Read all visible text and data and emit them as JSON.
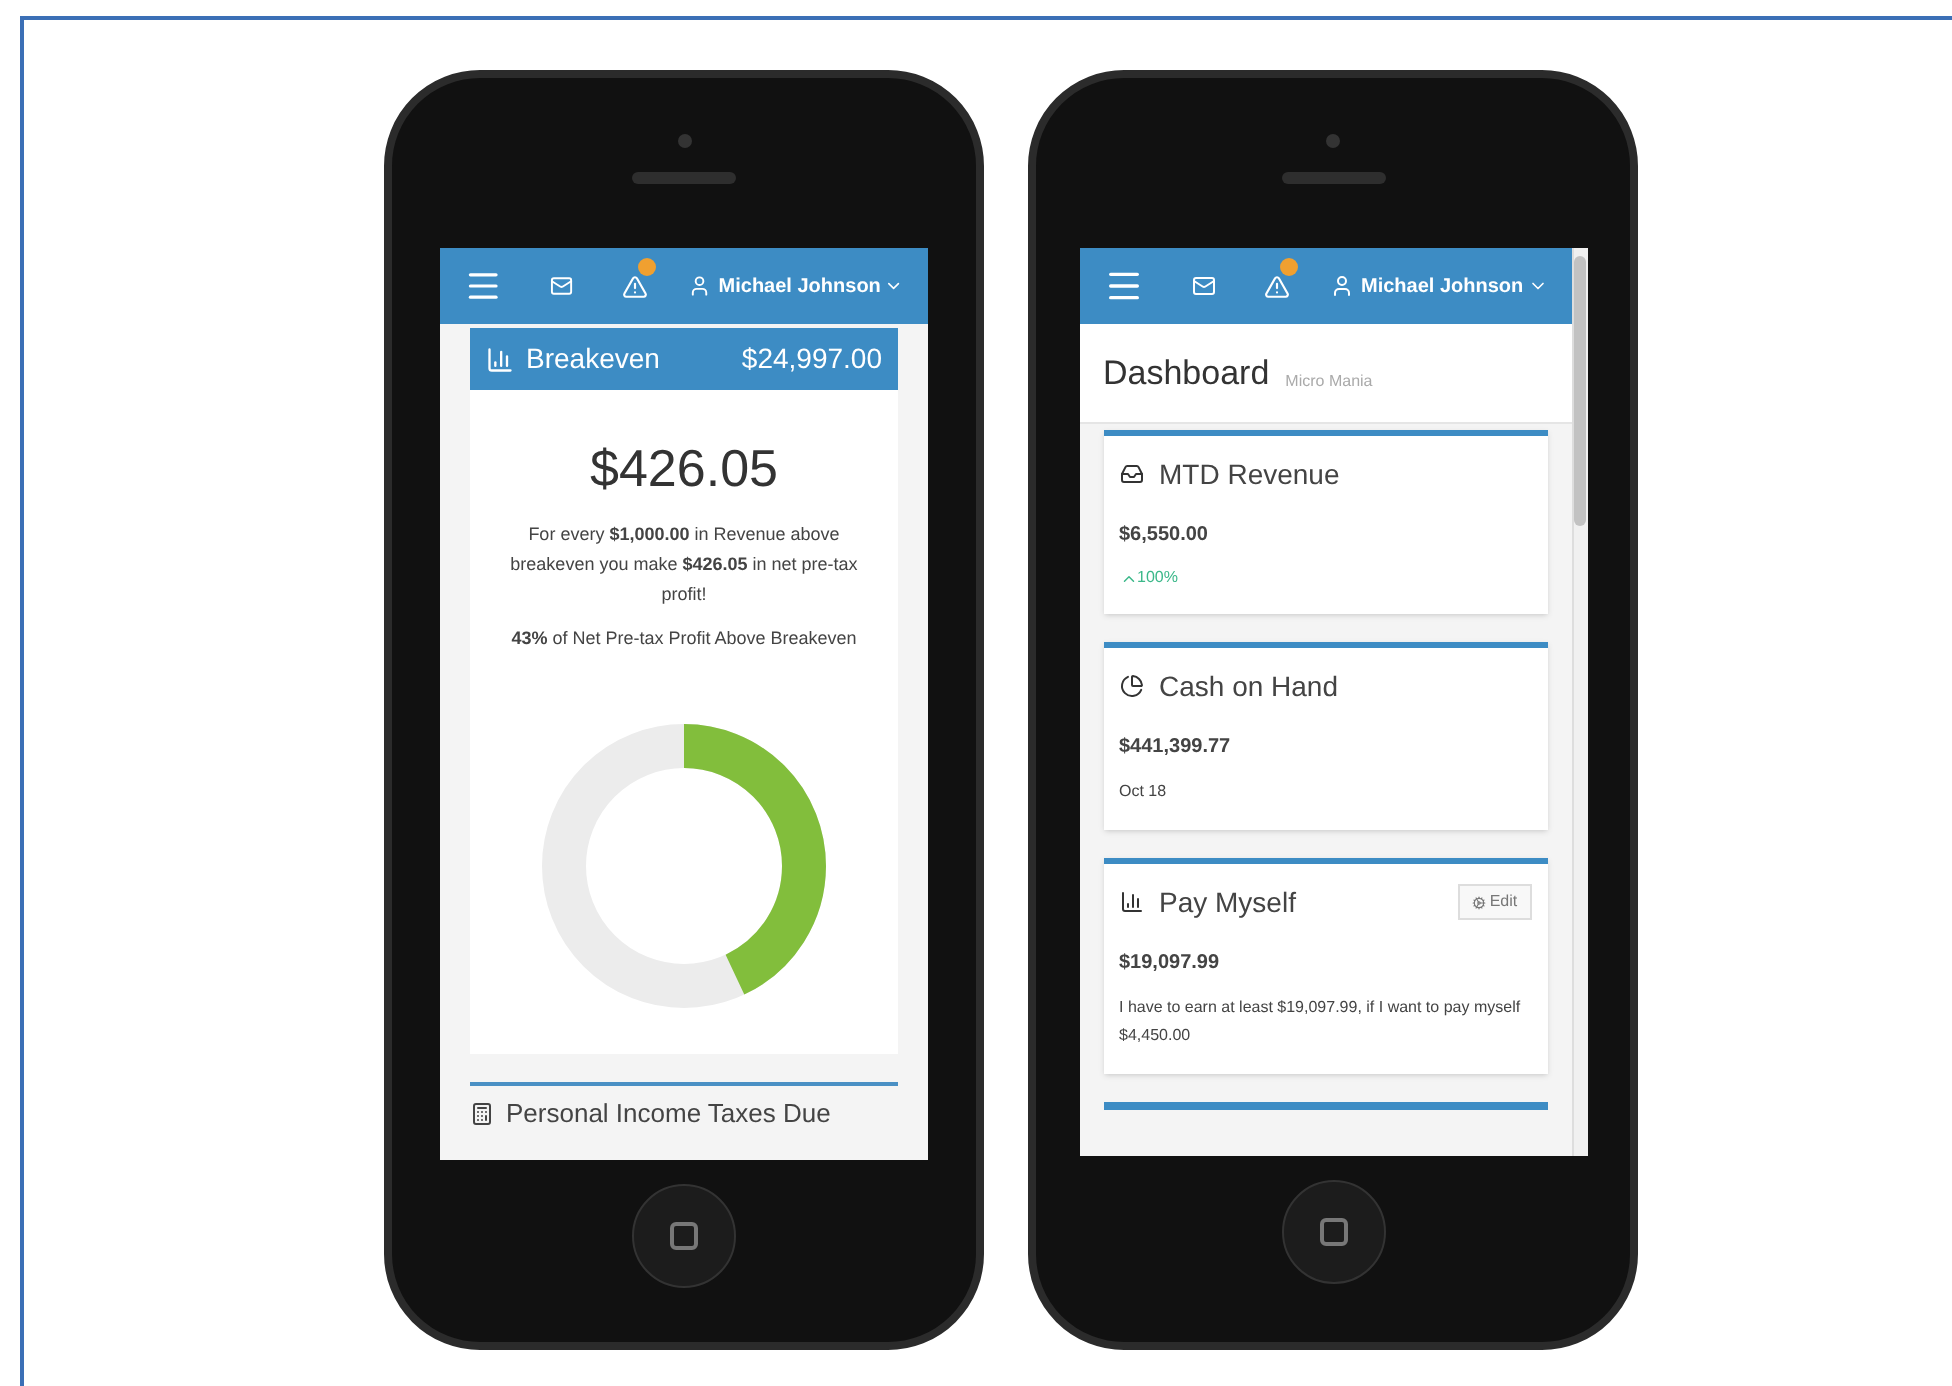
{
  "phones": [
    {
      "nav": {
        "user": "Michael Johnson"
      },
      "breakeven": {
        "title": "Breakeven",
        "amount": "$24,997.00",
        "value": "$426.05",
        "description": "For every **$1,000.00** in Revenue above breakeven you make **$426.05** in net pre-tax profit!",
        "share_label": "**43%** of Net Pre-tax Profit Above Breakeven",
        "level": 0.43
      },
      "next_panel": {
        "title": "Personal Income Taxes Due"
      }
    },
    {
      "nav": {
        "user": "Michael Johnson"
      },
      "heading": {
        "title": "Dashboard",
        "subtitle": "Micro Mania"
      },
      "cards": [
        {
          "kind": "revenue",
          "title": "MTD Revenue",
          "value": "$6,550.00",
          "note": "100%"
        },
        {
          "kind": "cash",
          "title": "Cash on Hand",
          "value": "$441,399.77",
          "note": "Oct 18"
        },
        {
          "kind": "pay",
          "title": "Pay Myself",
          "value": "$19,097.99",
          "note": "I have to earn at least $19,097.99, if I want to pay myself $4,450.00",
          "button": "Edit"
        }
      ]
    }
  ]
}
